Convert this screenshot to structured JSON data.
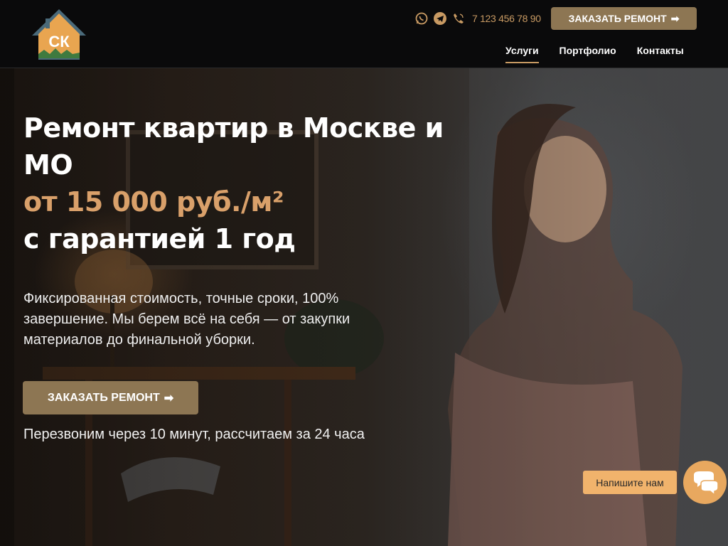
{
  "header": {
    "logo_text": "СК",
    "phone": "7 123 456 78 90",
    "cta_label": "ЗАКАЗАТЬ РЕМОНТ",
    "nav": [
      {
        "label": "Услуги",
        "active": true
      },
      {
        "label": "Портфолио",
        "active": false
      },
      {
        "label": "Контакты",
        "active": false
      }
    ],
    "icons": [
      "whatsapp-icon",
      "telegram-icon",
      "phone-icon"
    ]
  },
  "hero": {
    "title_line1": "Ремонт квартир в Москве и",
    "title_line2": "МО",
    "title_price": "от 15 000 руб./м²",
    "title_line4": "с гарантией 1 год",
    "lead": "Фиксированная стоимость, точные сроки, 100% завершение. Мы берем всё на себя — от закупки материалов до финальной уборки.",
    "cta_label": "ЗАКАЗАТЬ РЕМОНТ",
    "note": "Перезвоним через 10 минут, рассчитаем за 24 часа"
  },
  "chat": {
    "label": "Напишите нам"
  },
  "colors": {
    "accent": "#c89a63",
    "button": "#8d7653",
    "chat": "#f1b36c"
  }
}
